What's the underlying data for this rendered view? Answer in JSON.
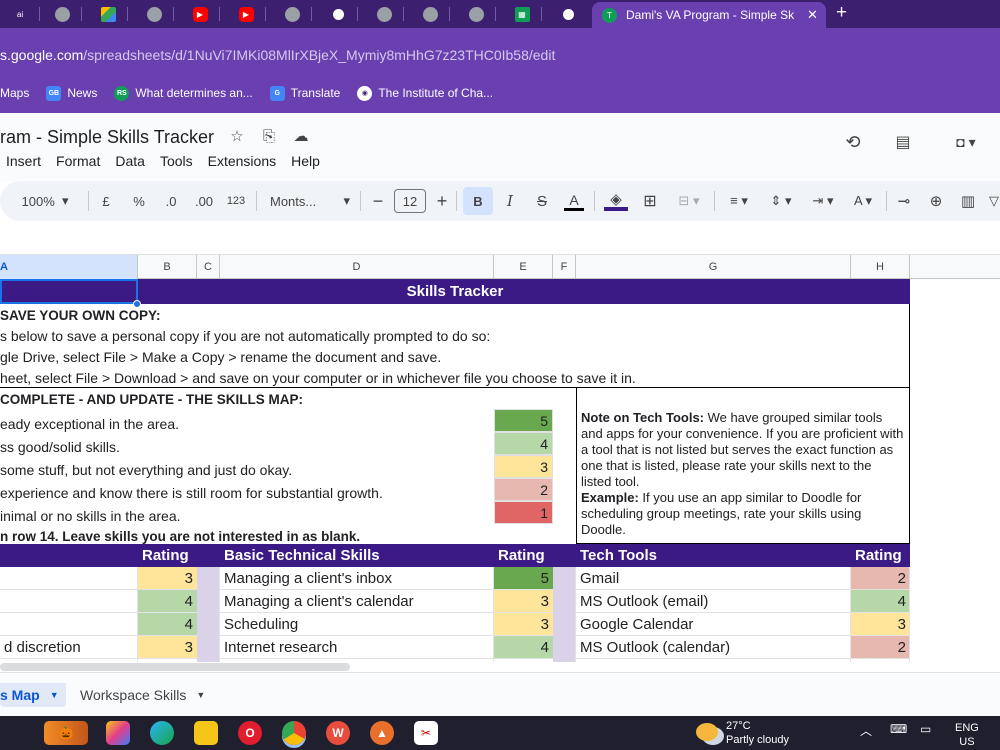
{
  "browser": {
    "active_tab_title": "Dami's VA Program - Simple Sk",
    "tab_close": "✕",
    "new_tab": "+",
    "url_host": "s.google.com",
    "url_path": "/spreadsheets/d/1NuVi7IMKi08MlIrXBjeX_Mymiy8mHhG7z23THC0Ib58/edit",
    "bookmarks": [
      {
        "label": "Maps",
        "icon": "maps-icon",
        "color": "#34a853"
      },
      {
        "label": "News",
        "icon": "news-icon",
        "color": "#4285f4",
        "badge": "GB"
      },
      {
        "label": "What determines an...",
        "icon": "rs-icon",
        "color": "#0f9d58",
        "badge": "RS"
      },
      {
        "label": "Translate",
        "icon": "translate-icon",
        "color": "#4285f4",
        "badge": "G"
      },
      {
        "label": "The Institute of Cha...",
        "icon": "institute-icon",
        "color": "#ffffff"
      }
    ]
  },
  "docs": {
    "title": "ram - Simple Skills Tracker",
    "menu": [
      "Insert",
      "Format",
      "Data",
      "Tools",
      "Extensions",
      "Help"
    ]
  },
  "toolbar": {
    "zoom": "100%",
    "currency": "£",
    "percent": "%",
    "dec_decrease": ".0",
    "dec_increase": ".00",
    "number_format": "123",
    "font": "Monts...",
    "font_size": "12",
    "minus": "−",
    "plus": "+",
    "bold": "B",
    "italic": "I",
    "strike": "S",
    "text_color": "A"
  },
  "columns": [
    "A",
    "B",
    "C",
    "D",
    "E",
    "F",
    "G",
    "H"
  ],
  "sheet": {
    "banner": "Skills Tracker",
    "save_heading": "SAVE YOUR OWN COPY:",
    "save_lines": [
      "s below to save a personal copy if you are not automatically prompted to do so:",
      "gle Drive, select File > Make a Copy > rename the document and save.",
      "heet, select File > Download > and save on your computer or in whichever file you choose to save it in."
    ],
    "complete_heading": "COMPLETE - AND UPDATE - THE SKILLS MAP:",
    "legend": [
      {
        "text": "eady exceptional in the area.",
        "value": "5",
        "color": "#6aa84f"
      },
      {
        "text": "ss good/solid skills.",
        "value": "4",
        "color": "#b6d7a8"
      },
      {
        "text": "some stuff, but not everything and just do okay.",
        "value": "3",
        "color": "#ffe599"
      },
      {
        "text": "experience and know there is still room for substantial growth.",
        "value": "2",
        "color": "#e6b8af"
      },
      {
        "text": "inimal or no skills in the area.",
        "value": "1",
        "color": "#e06666"
      }
    ],
    "row14_note": "n row 14. Leave skills you are not interested in as blank.",
    "note_label": "Note on Tech Tools:",
    "note_text": " We have grouped similar tools and apps for your convenience. If you are proficient with a tool that is not listed but serves the exact function as one that is listed, please rate your skills next to the listed tool.",
    "example_label": "Example:",
    "example_text": " If you use an app similar to Doodle for scheduling group meetings, rate your skills using Doodle.",
    "headers": {
      "rating_b": "Rating",
      "basic": "Basic Technical Skills",
      "rating_e": "Rating",
      "tech": "Tech Tools",
      "rating_h": "Rating"
    },
    "rows": [
      {
        "a": "",
        "b": "3",
        "b_color": "#ffe599",
        "d": "Managing a client's inbox",
        "e": "5",
        "e_color": "#6aa84f",
        "g": "Gmail",
        "h": "2",
        "h_color": "#e6b8af"
      },
      {
        "a": "",
        "b": "4",
        "b_color": "#b6d7a8",
        "d": "Managing a client's calendar",
        "e": "3",
        "e_color": "#ffe599",
        "g": "MS Outlook (email)",
        "h": "4",
        "h_color": "#b6d7a8"
      },
      {
        "a": "",
        "b": "4",
        "b_color": "#b6d7a8",
        "d": "Scheduling",
        "e": "3",
        "e_color": "#ffe599",
        "g": "Google Calendar",
        "h": "3",
        "h_color": "#ffe599"
      },
      {
        "a": "d discretion",
        "b": "3",
        "b_color": "#ffe599",
        "d": "Internet research",
        "e": "4",
        "e_color": "#b6d7a8",
        "g": "MS Outlook (calendar)",
        "h": "2",
        "h_color": "#e6b8af"
      }
    ]
  },
  "sheet_tabs": [
    "s Map",
    "Workspace Skills"
  ],
  "taskbar": {
    "temp": "27°C",
    "weather": "Partly cloudy",
    "lang1": "ENG",
    "lang2": "US"
  }
}
